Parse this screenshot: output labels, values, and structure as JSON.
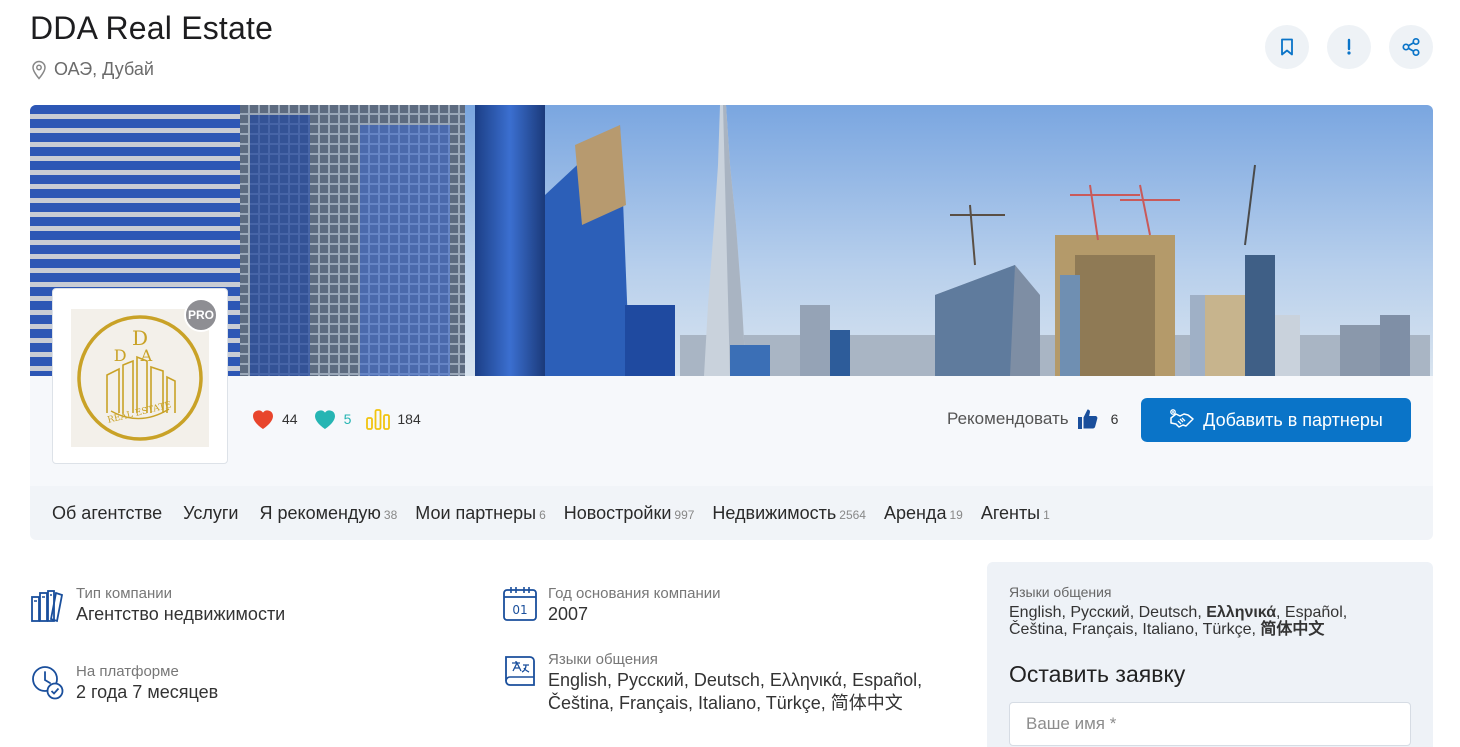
{
  "header": {
    "title": "DDA Real Estate",
    "location": "ОАЭ, Дубай",
    "actions": [
      {
        "icon": "bookmark-icon"
      },
      {
        "icon": "exclamation-icon"
      },
      {
        "icon": "share-icon"
      }
    ]
  },
  "profile": {
    "pro_badge": "PRO",
    "logo_text": [
      "D",
      "DA",
      "REAL ESTATE"
    ],
    "stats": {
      "likes": "44",
      "followers": "5",
      "views": "184"
    },
    "recommend_label": "Рекомендовать",
    "recommend_count": "6",
    "partner_button": "Добавить в партнеры"
  },
  "tabs": [
    {
      "label": "Об агентстве",
      "count": ""
    },
    {
      "label": "Услуги",
      "count": ""
    },
    {
      "label": "Я рекомендую",
      "count": "38"
    },
    {
      "label": "Мои партнеры",
      "count": "6"
    },
    {
      "label": "Новостройки",
      "count": "997"
    },
    {
      "label": "Недвижимость",
      "count": "2564"
    },
    {
      "label": "Аренда",
      "count": "19"
    },
    {
      "label": "Агенты",
      "count": "1"
    }
  ],
  "info": {
    "company_type_label": "Тип компании",
    "company_type_value": "Агентство недвижимости",
    "founded_label": "Год основания компании",
    "founded_value": "2007",
    "calendar_day": "01",
    "platform_label": "На платформе",
    "platform_value": "2 года 7 месяцев",
    "languages_label": "Языки общения",
    "languages_line1": "English, Русский, Deutsch, Ελληνικά, Español,",
    "languages_line2": "Čeština, Français, Italiano, Türkçe, 简体中文"
  },
  "side_panel": {
    "languages_label": "Языки общения",
    "lang_part1": "English, Русский, Deutsch, ",
    "lang_bold1": "Ελληνικά",
    "lang_part2": ", Español,",
    "lang_part3": "Čeština, Français, Italiano, Türkçe, ",
    "lang_bold2": "简体中文",
    "form_title": "Оставить заявку",
    "name_placeholder": "Ваше имя *"
  },
  "colors": {
    "accent": "#0a74c8",
    "heart": "#e8452c",
    "teal_heart": "#26b5b3",
    "views": "#f1c40f",
    "gold": "#c9a227",
    "thumb": "#1a4f9c"
  }
}
